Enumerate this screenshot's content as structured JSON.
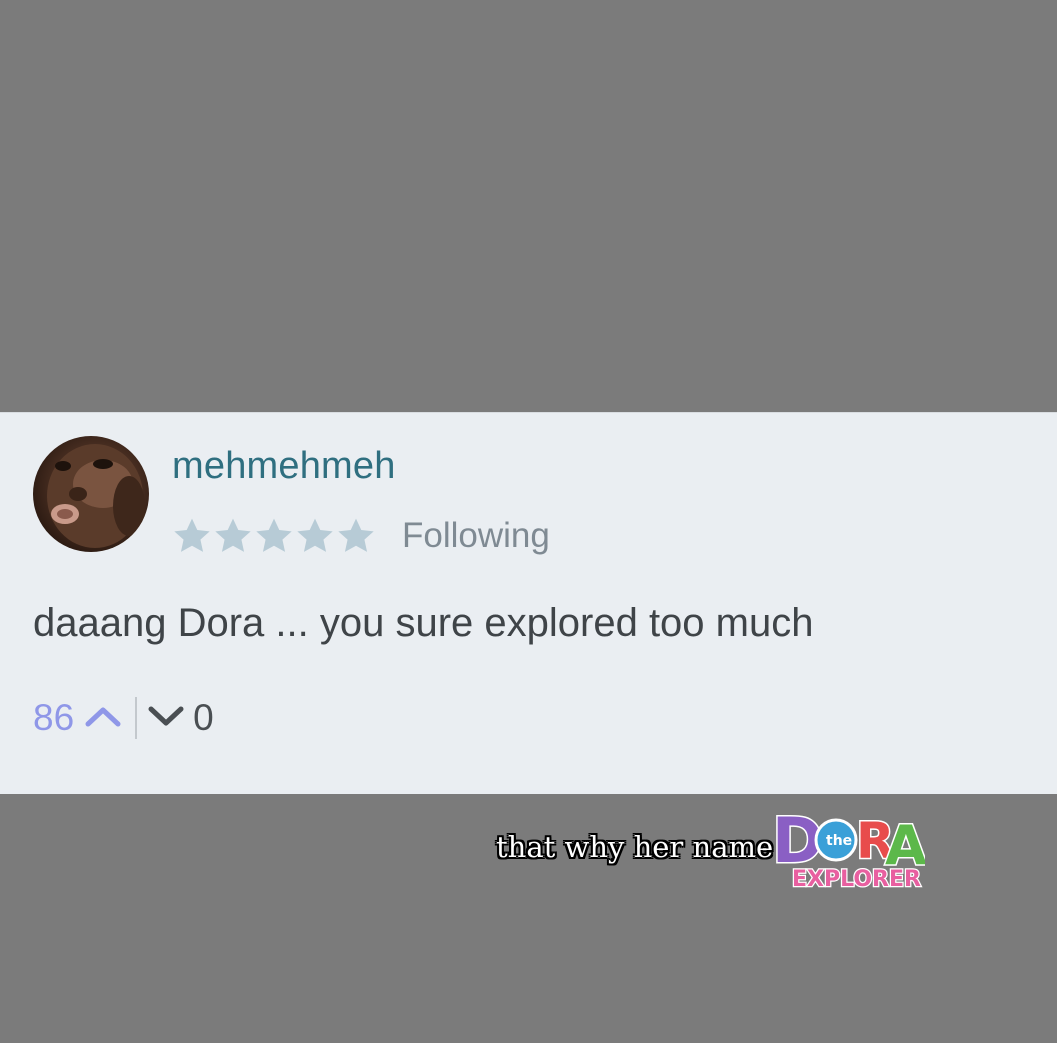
{
  "comment": {
    "username": "mehmehmeh",
    "rating_stars": 5,
    "following_label": "Following",
    "text": "daaang Dora ... you sure explored too much",
    "upvotes": "86",
    "downvotes": "0",
    "icons": {
      "avatar": "avatar",
      "stars": "star-icon",
      "upvote": "chevron-up-icon",
      "downvote": "chevron-down-icon"
    },
    "colors": {
      "card_background": "#eaeef2",
      "username": "#2f6f80",
      "stars": "#b7cbd6",
      "upvote": "#8f97e8"
    }
  },
  "caption": {
    "text": "that why her name"
  },
  "logo": {
    "top": "DORA",
    "small": "the",
    "bottom": "EXPLORER"
  },
  "background_color": "#7b7b7b"
}
